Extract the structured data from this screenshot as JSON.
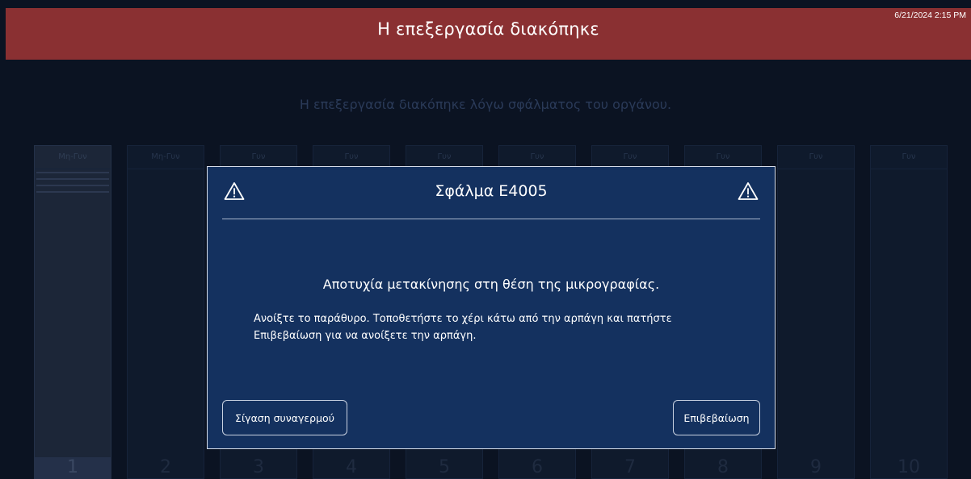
{
  "header": {
    "title": "Η επεξεργασία διακόπηκε",
    "timestamp": "6/21/2024 2:15 PM"
  },
  "background": {
    "message": "Η επεξεργασία διακόπηκε λόγω σφάλματος του οργάνου."
  },
  "slots": [
    {
      "status": "Μη-Γυν",
      "number": "1"
    },
    {
      "status": "Μη-Γυν",
      "number": "2"
    },
    {
      "status": "Γυν",
      "number": "3"
    },
    {
      "status": "Γυν",
      "number": "4"
    },
    {
      "status": "Γυν",
      "number": "5"
    },
    {
      "status": "Γυν",
      "number": "6"
    },
    {
      "status": "Γυν",
      "number": "7"
    },
    {
      "status": "Γυν",
      "number": "8"
    },
    {
      "status": "Γυν",
      "number": "9"
    },
    {
      "status": "Γυν",
      "number": "10"
    }
  ],
  "dialog": {
    "title": "Σφάλμα E4005",
    "icon": "warning-triangle-icon",
    "heading": "Αποτυχία μετακίνησης στη θέση της μικρογραφίας.",
    "body": "Ανοίξτε το παράθυρο. Τοποθετήστε το χέρι κάτω από την αρπάγη και πατήστε Επιβεβαίωση για να ανοίξετε την αρπάγη.",
    "silence_label": "Σίγαση συναγερμού",
    "confirm_label": "Επιβεβαίωση"
  },
  "colors": {
    "header_bg": "#8a3032",
    "dialog_bg": "#14315f",
    "screen_bg": "#0b1322"
  }
}
